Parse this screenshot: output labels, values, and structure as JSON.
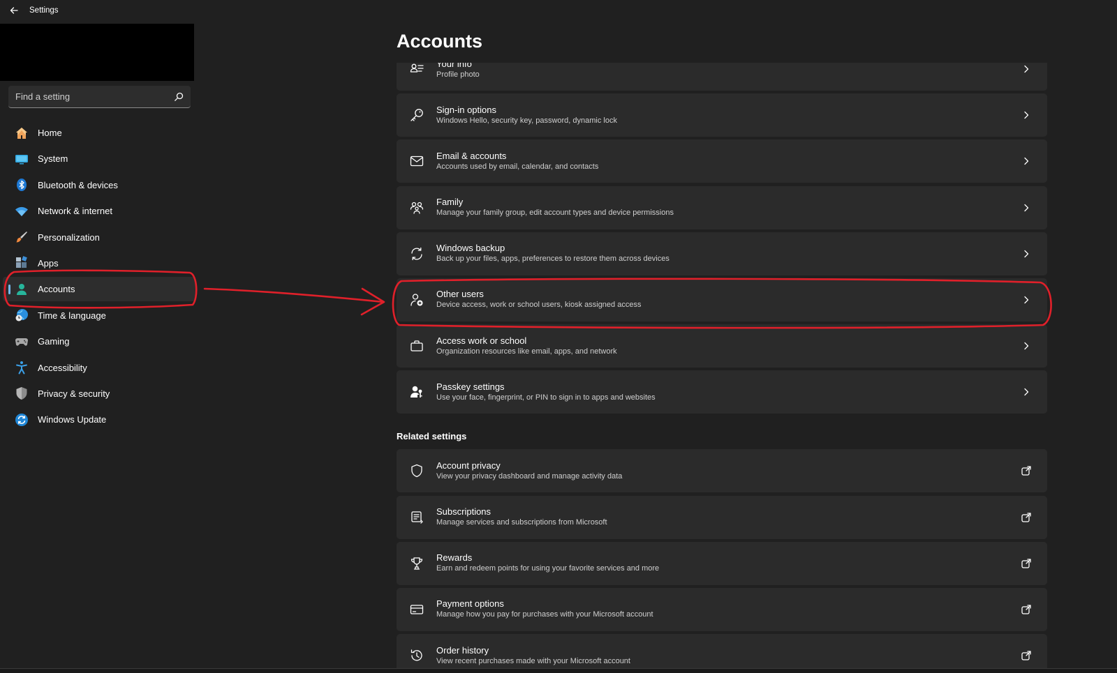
{
  "window": {
    "title": "Settings"
  },
  "search": {
    "placeholder": "Find a setting"
  },
  "sidebar": {
    "items": [
      {
        "label": "Home",
        "icon": "home-icon"
      },
      {
        "label": "System",
        "icon": "system-icon"
      },
      {
        "label": "Bluetooth & devices",
        "icon": "bluetooth-icon"
      },
      {
        "label": "Network & internet",
        "icon": "wifi-icon"
      },
      {
        "label": "Personalization",
        "icon": "brush-icon"
      },
      {
        "label": "Apps",
        "icon": "apps-icon"
      },
      {
        "label": "Accounts",
        "icon": "accounts-icon",
        "active": true
      },
      {
        "label": "Time & language",
        "icon": "globe-clock-icon"
      },
      {
        "label": "Gaming",
        "icon": "controller-icon"
      },
      {
        "label": "Accessibility",
        "icon": "accessibility-icon"
      },
      {
        "label": "Privacy & security",
        "icon": "shield-icon"
      },
      {
        "label": "Windows Update",
        "icon": "update-icon"
      }
    ]
  },
  "main": {
    "title": "Accounts",
    "cards": [
      {
        "title": "Your info",
        "subtitle": "Profile photo",
        "icon": "person-card-icon"
      },
      {
        "title": "Sign-in options",
        "subtitle": "Windows Hello, security key, password, dynamic lock",
        "icon": "key-icon"
      },
      {
        "title": "Email & accounts",
        "subtitle": "Accounts used by email, calendar, and contacts",
        "icon": "mail-icon"
      },
      {
        "title": "Family",
        "subtitle": "Manage your family group, edit account types and device permissions",
        "icon": "family-icon"
      },
      {
        "title": "Windows backup",
        "subtitle": "Back up your files, apps, preferences to restore them across devices",
        "icon": "sync-icon"
      },
      {
        "title": "Other users",
        "subtitle": "Device access, work or school users, kiosk assigned access",
        "icon": "person-add-icon"
      },
      {
        "title": "Access work or school",
        "subtitle": "Organization resources like email, apps, and network",
        "icon": "briefcase-icon"
      },
      {
        "title": "Passkey settings",
        "subtitle": "Use your face, fingerprint, or PIN to sign in to apps and websites",
        "icon": "person-key-icon"
      }
    ],
    "related_header": "Related settings",
    "related": [
      {
        "title": "Account privacy",
        "subtitle": "View your privacy dashboard and manage activity data",
        "icon": "shield-outline-icon"
      },
      {
        "title": "Subscriptions",
        "subtitle": "Manage services and subscriptions from Microsoft",
        "icon": "receipt-icon"
      },
      {
        "title": "Rewards",
        "subtitle": "Earn and redeem points for using your favorite services and more",
        "icon": "trophy-icon"
      },
      {
        "title": "Payment options",
        "subtitle": "Manage how you pay for purchases with your Microsoft account",
        "icon": "credit-card-icon"
      },
      {
        "title": "Order history",
        "subtitle": "View recent purchases made with your Microsoft account",
        "icon": "history-icon"
      }
    ]
  },
  "colors": {
    "background": "#202020",
    "card": "#2b2b2b",
    "accent": "#76b9ed",
    "annotation": "#e0202a"
  }
}
